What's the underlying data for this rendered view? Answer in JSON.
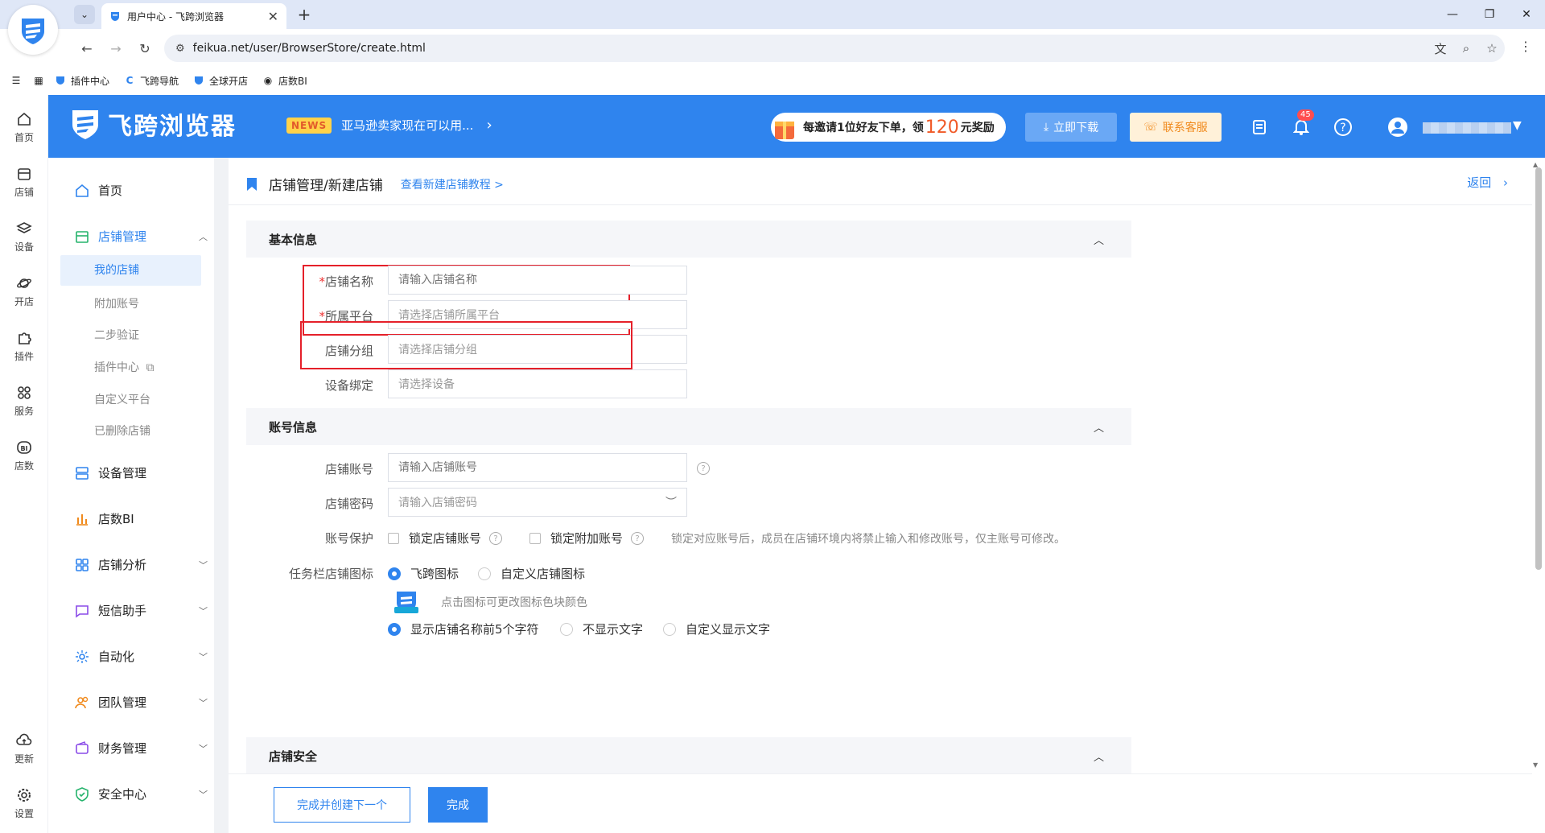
{
  "browser": {
    "tab_title": "用户中心 - 飞跨浏览器",
    "url": "feikua.net/user/BrowserStore/create.html",
    "bookmarks": [
      "插件中心",
      "飞跨导航",
      "全球开店",
      "店数BI"
    ]
  },
  "rail": [
    {
      "label": "首页"
    },
    {
      "label": "店铺"
    },
    {
      "label": "设备"
    },
    {
      "label": "开店"
    },
    {
      "label": "插件"
    },
    {
      "label": "服务"
    },
    {
      "label": "店数"
    },
    {
      "label": "更新"
    },
    {
      "label": "设置"
    }
  ],
  "header": {
    "brand": "飞跨浏览器",
    "news_badge": "NEWS",
    "news_text": "亚马逊卖家现在可以用...",
    "promo_before": "每邀请1位好友下单，领",
    "promo_num": "120",
    "promo_after": "元奖励",
    "download": "立即下载",
    "service": "联系客服",
    "notif_count": "45"
  },
  "sidebar": {
    "home": "首页",
    "store_mgmt": "店铺管理",
    "sub": [
      "我的店铺",
      "附加账号",
      "二步验证",
      "插件中心",
      "自定义平台",
      "已删除店铺"
    ],
    "device_mgmt": "设备管理",
    "bi": "店数BI",
    "analysis": "店铺分析",
    "sms": "短信助手",
    "automation": "自动化",
    "team": "团队管理",
    "finance": "财务管理",
    "security": "安全中心"
  },
  "page": {
    "title": "店铺管理/新建店铺",
    "tutorial": "查看新建店铺教程 >",
    "back": "返回"
  },
  "basic": {
    "section": "基本信息",
    "name_label": "店铺名称",
    "name_ph": "请输入店铺名称",
    "platform_label": "所属平台",
    "platform_ph": "请选择店铺所属平台",
    "group_label": "店铺分组",
    "group_ph": "请选择店铺分组",
    "device_label": "设备绑定",
    "device_ph": "请选择设备"
  },
  "account": {
    "section": "账号信息",
    "acct_label": "店铺账号",
    "acct_ph": "请输入店铺账号",
    "pwd_label": "店铺密码",
    "pwd_ph": "请输入店铺密码",
    "protect_label": "账号保护",
    "lock_store": "锁定店铺账号",
    "lock_extra": "锁定附加账号",
    "lock_note": "锁定对应账号后，成员在店铺环境内将禁止输入和修改账号，仅主账号可修改。",
    "taskbar_label": "任务栏店铺图标",
    "icon_feikua": "飞跨图标",
    "icon_custom": "自定义店铺图标",
    "icon_hint": "点击图标可更改图标色块颜色",
    "text_first5": "显示店铺名称前5个字符",
    "text_none": "不显示文字",
    "text_custom": "自定义显示文字"
  },
  "security": {
    "section": "店铺安全"
  },
  "footer": {
    "create_next": "完成并创建下一个",
    "done": "完成"
  },
  "colors": {
    "primary": "#2f84ee",
    "highlight_border": "#e5202a",
    "required": "#e33333"
  }
}
